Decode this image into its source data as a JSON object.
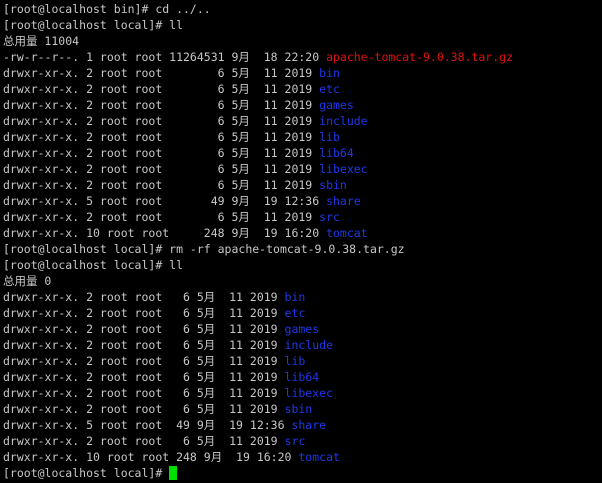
{
  "colors": {
    "background": "#000000",
    "text": "#c7c7c7",
    "archive": "#e01010",
    "directory": "#1e38e8",
    "cursor": "#00e000"
  },
  "lines": [
    {
      "segments": [
        {
          "text": "[root@localhost bin]# cd ../.."
        }
      ]
    },
    {
      "segments": [
        {
          "text": "[root@localhost local]# ll"
        }
      ]
    },
    {
      "segments": [
        {
          "text": "总用量 11004"
        }
      ]
    },
    {
      "segments": [
        {
          "text": "-rw-r--r--. 1 root root 11264531 9月  18 22:20 "
        },
        {
          "text": "apache-tomcat-9.0.38.tar.gz",
          "color": "red"
        }
      ]
    },
    {
      "segments": [
        {
          "text": "drwxr-xr-x. 2 root root        6 5月  11 2019 "
        },
        {
          "text": "bin",
          "color": "blue"
        }
      ]
    },
    {
      "segments": [
        {
          "text": "drwxr-xr-x. 2 root root        6 5月  11 2019 "
        },
        {
          "text": "etc",
          "color": "blue"
        }
      ]
    },
    {
      "segments": [
        {
          "text": "drwxr-xr-x. 2 root root        6 5月  11 2019 "
        },
        {
          "text": "games",
          "color": "blue"
        }
      ]
    },
    {
      "segments": [
        {
          "text": "drwxr-xr-x. 2 root root        6 5月  11 2019 "
        },
        {
          "text": "include",
          "color": "blue"
        }
      ]
    },
    {
      "segments": [
        {
          "text": "drwxr-xr-x. 2 root root        6 5月  11 2019 "
        },
        {
          "text": "lib",
          "color": "blue"
        }
      ]
    },
    {
      "segments": [
        {
          "text": "drwxr-xr-x. 2 root root        6 5月  11 2019 "
        },
        {
          "text": "lib64",
          "color": "blue"
        }
      ]
    },
    {
      "segments": [
        {
          "text": "drwxr-xr-x. 2 root root        6 5月  11 2019 "
        },
        {
          "text": "libexec",
          "color": "blue"
        }
      ]
    },
    {
      "segments": [
        {
          "text": "drwxr-xr-x. 2 root root        6 5月  11 2019 "
        },
        {
          "text": "sbin",
          "color": "blue"
        }
      ]
    },
    {
      "segments": [
        {
          "text": "drwxr-xr-x. 5 root root       49 9月  19 12:36 "
        },
        {
          "text": "share",
          "color": "blue"
        }
      ]
    },
    {
      "segments": [
        {
          "text": "drwxr-xr-x. 2 root root        6 5月  11 2019 "
        },
        {
          "text": "src",
          "color": "blue"
        }
      ]
    },
    {
      "segments": [
        {
          "text": "drwxr-xr-x. 10 root root     248 9月  19 16:20 "
        },
        {
          "text": "tomcat",
          "color": "blue"
        }
      ]
    },
    {
      "segments": [
        {
          "text": "[root@localhost local]# rm -rf apache-tomcat-9.0.38.tar.gz"
        }
      ]
    },
    {
      "segments": [
        {
          "text": "[root@localhost local]# ll"
        }
      ]
    },
    {
      "segments": [
        {
          "text": "总用量 0"
        }
      ]
    },
    {
      "segments": [
        {
          "text": "drwxr-xr-x. 2 root root   6 5月  11 2019 "
        },
        {
          "text": "bin",
          "color": "blue"
        }
      ]
    },
    {
      "segments": [
        {
          "text": "drwxr-xr-x. 2 root root   6 5月  11 2019 "
        },
        {
          "text": "etc",
          "color": "blue"
        }
      ]
    },
    {
      "segments": [
        {
          "text": "drwxr-xr-x. 2 root root   6 5月  11 2019 "
        },
        {
          "text": "games",
          "color": "blue"
        }
      ]
    },
    {
      "segments": [
        {
          "text": "drwxr-xr-x. 2 root root   6 5月  11 2019 "
        },
        {
          "text": "include",
          "color": "blue"
        }
      ]
    },
    {
      "segments": [
        {
          "text": "drwxr-xr-x. 2 root root   6 5月  11 2019 "
        },
        {
          "text": "lib",
          "color": "blue"
        }
      ]
    },
    {
      "segments": [
        {
          "text": "drwxr-xr-x. 2 root root   6 5月  11 2019 "
        },
        {
          "text": "lib64",
          "color": "blue"
        }
      ]
    },
    {
      "segments": [
        {
          "text": "drwxr-xr-x. 2 root root   6 5月  11 2019 "
        },
        {
          "text": "libexec",
          "color": "blue"
        }
      ]
    },
    {
      "segments": [
        {
          "text": "drwxr-xr-x. 2 root root   6 5月  11 2019 "
        },
        {
          "text": "sbin",
          "color": "blue"
        }
      ]
    },
    {
      "segments": [
        {
          "text": "drwxr-xr-x. 5 root root  49 9月  19 12:36 "
        },
        {
          "text": "share",
          "color": "blue"
        }
      ]
    },
    {
      "segments": [
        {
          "text": "drwxr-xr-x. 2 root root   6 5月  11 2019 "
        },
        {
          "text": "src",
          "color": "blue"
        }
      ]
    },
    {
      "segments": [
        {
          "text": "drwxr-xr-x. 10 root root 248 9月  19 16:20 "
        },
        {
          "text": "tomcat",
          "color": "blue"
        }
      ]
    }
  ],
  "prompt": {
    "text": "[root@localhost local]# "
  }
}
